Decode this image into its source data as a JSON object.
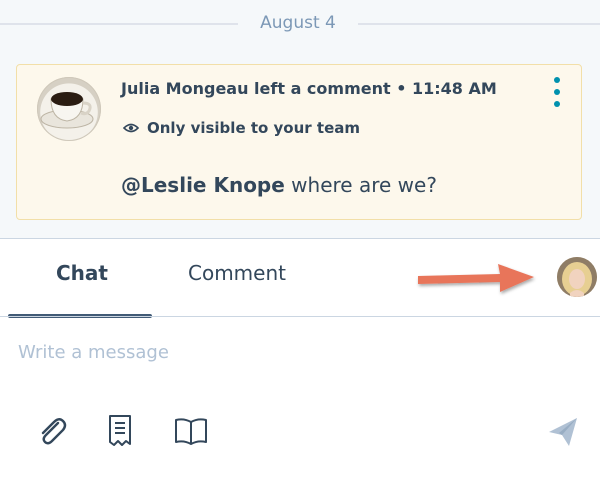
{
  "feed": {
    "date": "August 4",
    "comment": {
      "header": "Julia Mongeau left a comment • 11:48 AM",
      "visibility": "Only visible to your team",
      "mention": "@Leslie Knope",
      "body": " where are we?"
    }
  },
  "composer": {
    "tabs": [
      {
        "label": "Chat",
        "active": true
      },
      {
        "label": "Comment",
        "active": false
      }
    ],
    "message_placeholder": "Write a message"
  },
  "icons": {
    "more": "vertical-ellipsis-icon",
    "visibility": "eye-icon",
    "attach": "paperclip-icon",
    "snippet": "document-icon",
    "knowledge": "book-icon",
    "send": "paper-plane-icon",
    "annotation": "arrow-icon"
  },
  "colors": {
    "accent": "#0091ae",
    "text": "#33475b",
    "placeholder": "#b0c1d4",
    "arrow": "#e8745a",
    "card_bg": "#fdf8ec"
  }
}
